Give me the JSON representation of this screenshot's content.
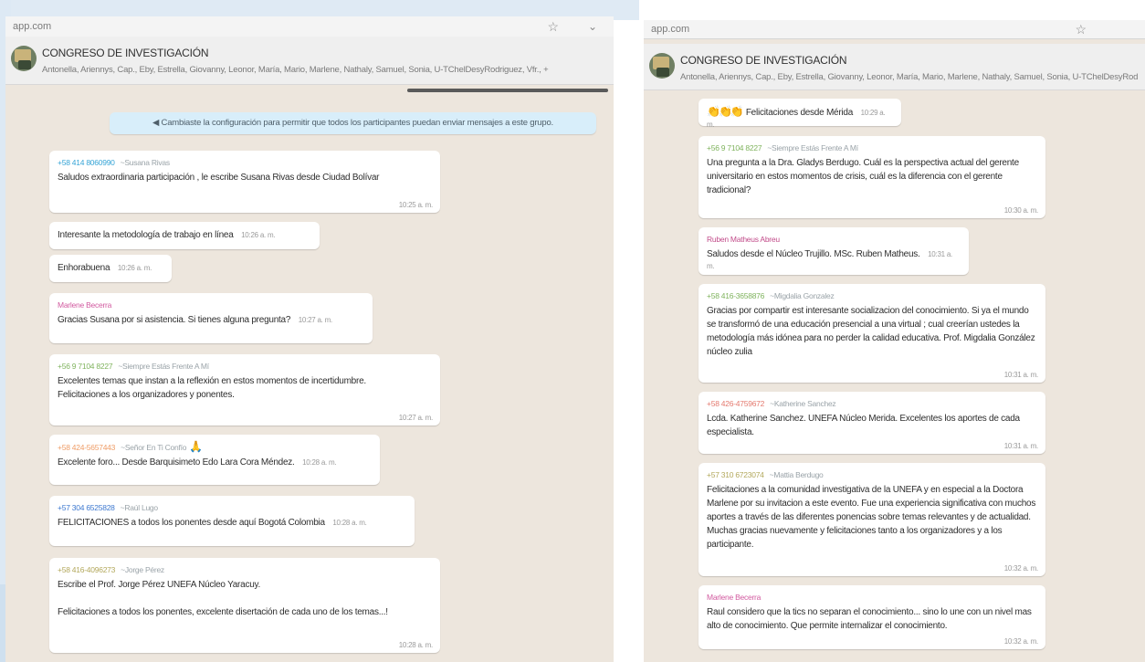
{
  "colors": {
    "chat_bg": "#ede6dd",
    "bubble_bg": "#ffffff",
    "system_bg": "#d8eefa",
    "header_bg": "#efefef"
  },
  "left": {
    "url": "app.com",
    "chat": {
      "title": "CONGRESO DE INVESTIGACIÓN",
      "participants": "Antonella, Ariennys, Cap., Eby, Estrella, Giovanny, Leonor, María, Mario, Marlene, Nathaly, Samuel, Sonia, U-TChelDesyRodriguez, Vfr., +"
    },
    "system_message": "◀ Cambiaste la configuración para permitir que todos los participantes puedan enviar mensajes a este grupo.",
    "messages": [
      {
        "phone": "+58 414 8060990",
        "alias": "~Susana Rivas",
        "text": "Saludos extraordinaria participación , le escribe Susana Rivas desde Ciudad Bolívar",
        "time": "10:25 a. m."
      },
      {
        "text": "Interesante la metodología de trabajo en línea",
        "time": "10:26 a. m."
      },
      {
        "text": "Enhorabuena",
        "time": "10:26 a. m."
      },
      {
        "sender": "Marlene Becerra",
        "text": "Gracias Susana por si asistencia. Si tienes alguna pregunta?",
        "time": "10:27 a. m."
      },
      {
        "phone": "+56 9 7104 8227",
        "alias": "~Siempre Estás Frente A Mí",
        "text": "Excelentes temas que instan a la  reflexión  en estos momentos  de incertidumbre.\nFelicitaciones  a los  organizadores y ponentes.",
        "time": "10:27 a. m."
      },
      {
        "phone": "+58 424-5657443",
        "alias": "~Señor En Ti Confío",
        "text": "Excelente foro... Desde Barquisimeto  Edo Lara  Cora Méndez.",
        "time": "10:28 a. m."
      },
      {
        "phone": "+57 304 6525828",
        "alias": "~Raúl Lugo",
        "text": "FELICITACIONES a todos los ponentes desde aquí Bogotá Colombia",
        "time": "10:28 a. m."
      },
      {
        "phone": "+58 416-4096273",
        "alias": "~Jorge Pérez",
        "text": "Escribe el Prof. Jorge Pérez UNEFA Núcleo Yaracuy.\n\nFelicitaciones a todos los ponentes, excelente disertación de cada uno de los temas...!",
        "time": "10:28 a. m."
      }
    ]
  },
  "right": {
    "url": "app.com",
    "chat": {
      "title": "CONGRESO DE INVESTIGACIÓN",
      "participants": "Antonella, Ariennys, Cap., Eby, Estrella, Giovanny, Leonor, María, Mario, Marlene, Nathaly, Samuel, Sonia, U-TChelDesyRod"
    },
    "messages": [
      {
        "text": "Felicitaciones desde Mérida",
        "time": "10:29 a. m."
      },
      {
        "phone": "+56 9 7104 8227",
        "alias": "~Siempre Estás Frente A Mí",
        "text": "Una pregunta a la Dra. Gladys  Berdugo. Cuál es la perspectiva  actual del gerente universitario   en estos momentos  de crisis, cuál es la diferencia  con el gerente tradicional?",
        "time": "10:30 a. m."
      },
      {
        "sender": "Ruben Matheus Abreu",
        "text": "Saludos desde el Núcleo Trujillo. MSc. Ruben Matheus.",
        "time": "10:31 a. m."
      },
      {
        "phone": "+58 416-3658876",
        "alias": "~Migdalia Gonzalez",
        "text": "Gracias por compartir est interesante socializacion del conocimiento. Si ya el mundo se transformó de una educación presencial a una virtual ; cual creerían ustedes la metodología más idónea para no perder la calidad educativa. Prof. Migdalia González núcleo zulia",
        "time": "10:31 a. m."
      },
      {
        "phone": "+58 426-4759672",
        "alias": "~Katherine Sanchez",
        "text": "Lcda. Katherine Sanchez.  UNEFA Núcleo Merida. Excelentes los aportes de cada especialista.",
        "time": "10:31 a. m."
      },
      {
        "phone": "+57 310 6723074",
        "alias": "~Mattia Berdugo",
        "text": "Felicitaciones a la comunidad investigativa de la UNEFA y en especial a la Doctora Marlene por su invitacion a este evento. Fue una experiencia significativa con muchos aportes a través de las diferentes ponencias sobre temas relevantes y de actualidad. Muchas gracias nuevamente y felicitaciones tanto a los organizadores y a los participante.",
        "time": "10:32 a. m."
      },
      {
        "sender": "Marlene Becerra",
        "text": "Raul considero que la tics  no separan el conocimiento... sino lo une con un nivel mas alto de conocimiento. Que permite internalizar el conocimiento.",
        "time": "10:32 a. m."
      }
    ]
  }
}
